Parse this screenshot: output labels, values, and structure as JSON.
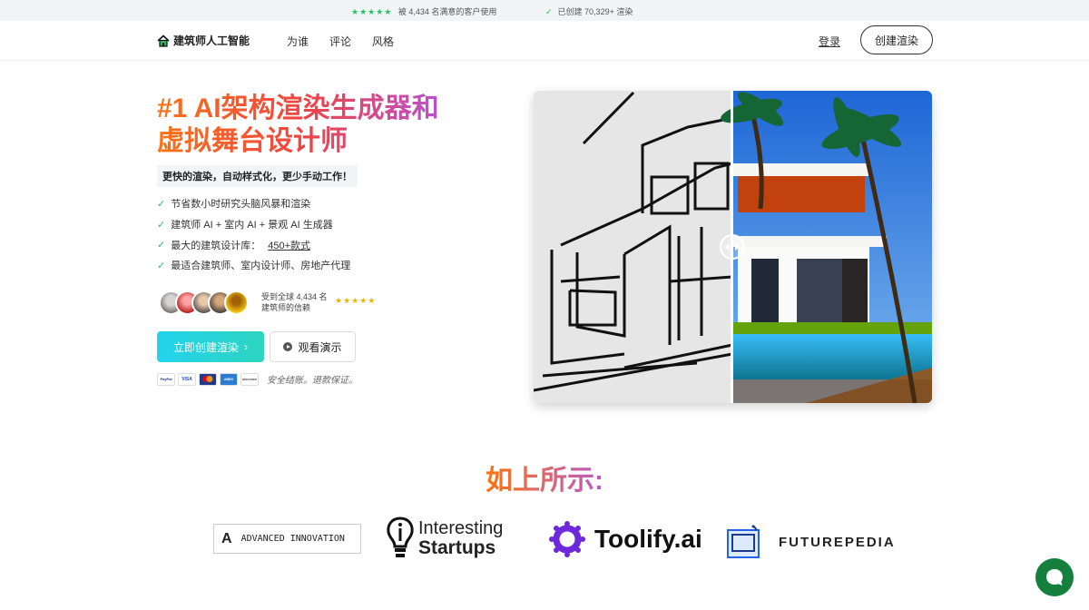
{
  "topbar": {
    "stars": "★★★★★",
    "reviews_text": "被 4,434 名满意的客户使用",
    "created_text": "已创建 70,329+ 渲染"
  },
  "nav": {
    "logo_text": "建筑师人工智能",
    "links": [
      "为谁",
      "评论",
      "风格"
    ],
    "login": "登录",
    "create_button": "创建渲染"
  },
  "hero": {
    "title_line1": "#1 AI架构渲染生成器和",
    "title_line2": "虚拟舞台设计师",
    "subtitle": "更快的渲染，自动样式化，更少手动工作！",
    "features": [
      "节省数小时研究头脑风暴和渲染",
      "建筑师 AI + 室内 AI + 景观 AI 生成器",
      "最大的建筑设计库：",
      "最适合建筑师、室内设计师、房地产代理"
    ],
    "styles_link": "450+款式",
    "trust_line1": "受到全球 4,434 名",
    "trust_line2": "建筑师的信赖",
    "trust_stars": "★★★★★",
    "primary_button": "立即创建渲染",
    "demo_button": "观看演示",
    "payment_note": "安全结账。退款保证。",
    "cards": [
      "PayPal",
      "VISA",
      "MC",
      "AMEX",
      "DISCOVER"
    ]
  },
  "press": {
    "heading": "如上所示:",
    "advanced": "ADVANCED INNOVATION",
    "advanced_mark": "A",
    "interesting_line1": "Interesting",
    "interesting_line2": "Startups",
    "toolify": "Toolify.ai",
    "futurepedia": "FUTUREPEDIA"
  },
  "colors": {
    "accent_green": "#22c55e",
    "title_gradient": [
      "#f97316",
      "#ef4444",
      "#a855f7"
    ],
    "cta_gradient": [
      "#22d3ee",
      "#2dd4bf"
    ],
    "chat_green": "#15803d"
  },
  "icons": [
    "logo-house-icon",
    "check-icon",
    "chevron-right-icon",
    "play-icon",
    "compare-slider-icon",
    "chat-icon"
  ]
}
